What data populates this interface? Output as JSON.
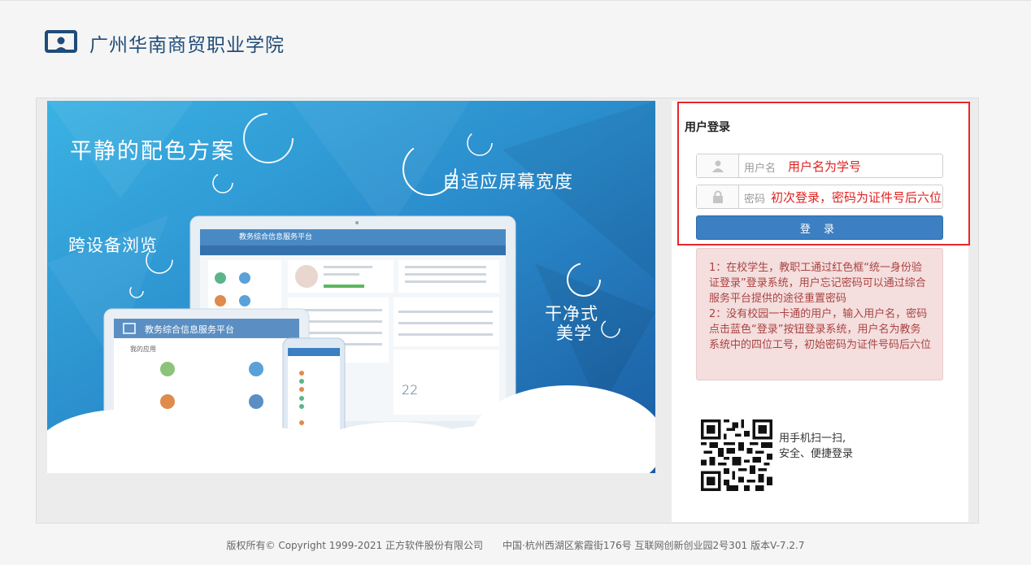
{
  "header": {
    "school_name": "广州华南商贸职业学院",
    "logo_icon": "monitor-user-icon"
  },
  "banner": {
    "slogan_1": "平静的配色方案",
    "slogan_2": "自适应屏幕宽度",
    "slogan_3": "跨设备浏览",
    "slogan_4a": "干净式",
    "slogan_4b": "美学",
    "device_title": "教务综合信息服务平台",
    "device_subtitle": "我的应用",
    "date_number": "22"
  },
  "login": {
    "title": "用户登录",
    "username_placeholder": "用户名",
    "username_hint": "用户名为学号",
    "password_placeholder": "密码",
    "password_hint": "初次登录，密码为证件号后六位",
    "button_label": "登 录",
    "user_icon": "user-icon",
    "lock_icon": "lock-icon"
  },
  "notice": {
    "line_1": "1：在校学生，教职工通过红色框“统一身份验证登录”登录系统，用户忘记密码可以通过综合服务平台提供的途径重置密码",
    "line_2": "2：没有校园一卡通的用户，输入用户名，密码点击蓝色“登录”按钮登录系统，用户名为教务系统中的四位工号，初始密码为证件号码后六位"
  },
  "qr": {
    "line_1": "用手机扫一扫,",
    "line_2": "安全、便捷登录"
  },
  "footer": {
    "copyright": "版权所有© Copyright 1999-2021 正方软件股份有限公司",
    "address": "中国·杭州西湖区紫霞街176号 互联网创新创业园2号301",
    "version": "版本V-7.2.7"
  },
  "colors": {
    "brand": "#1f4c78",
    "button": "#3c7fc2",
    "hint_red": "#e0201f",
    "notice_bg": "#f4dede"
  }
}
